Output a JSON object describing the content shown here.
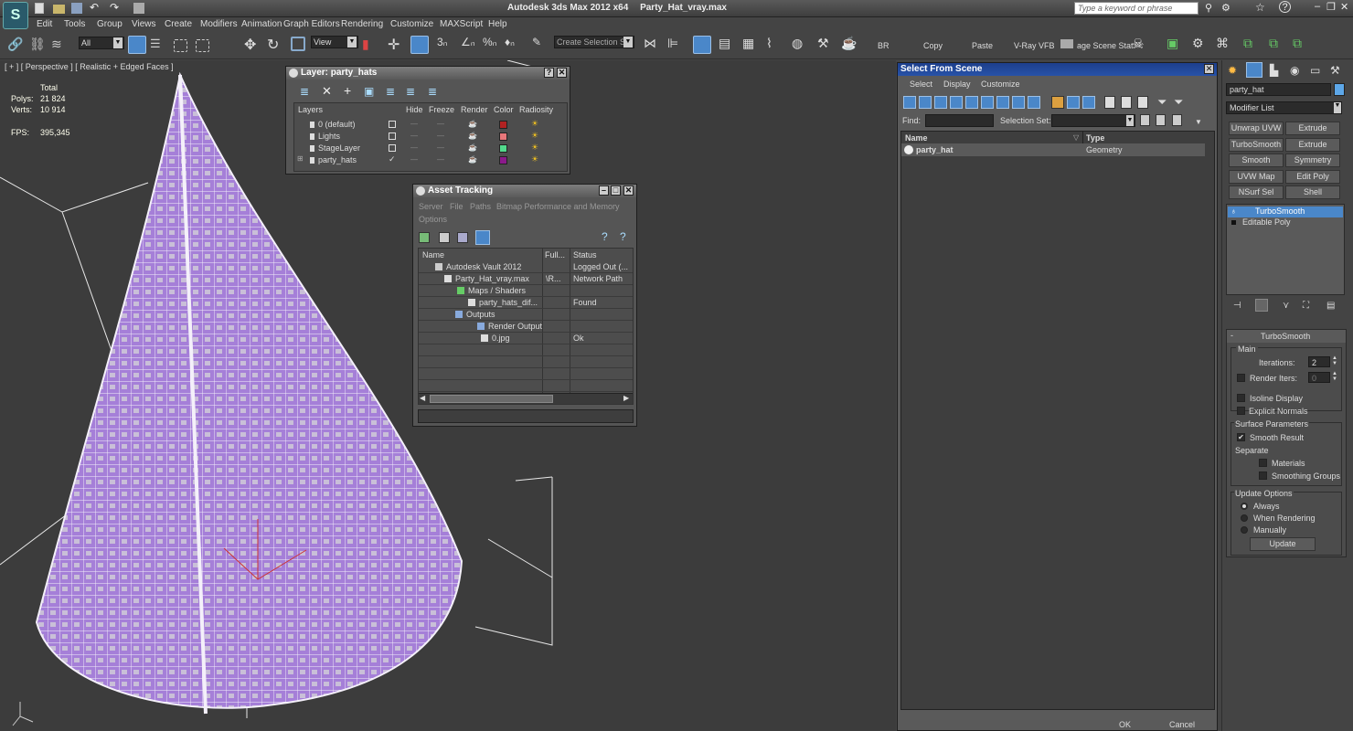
{
  "title": {
    "app": "Autodesk 3ds Max  2012 x64",
    "file": "Party_Hat_vray.max",
    "search_placeholder": "Type a keyword or phrase"
  },
  "menu": [
    "Edit",
    "Tools",
    "Group",
    "Views",
    "Create",
    "Modifiers",
    "Animation",
    "Graph Editors",
    "Rendering",
    "Customize",
    "MAXScript",
    "Help"
  ],
  "toolbar": {
    "filter": "All",
    "view": "View",
    "selset_placeholder": "Create Selection Se",
    "br": "BR",
    "copy": "Copy",
    "paste": "Paste",
    "vfb": "V-Ray VFB",
    "scene_states": "age Scene Stat"
  },
  "viewport": {
    "label": "[ + ] [ Perspective ] [ Realistic + Edged Faces ]",
    "stats": {
      "total_label": "Total",
      "polys_label": "Polys:",
      "polys": "21 824",
      "verts_label": "Verts:",
      "verts": "10 914",
      "fps_label": "FPS:",
      "fps": "395,345"
    },
    "mesh_color": "#a57fd8"
  },
  "layer_dialog": {
    "title": "Layer: party_hats",
    "columns": [
      "Layers",
      "Hide",
      "Freeze",
      "Render",
      "Color",
      "Radiosity"
    ],
    "rows": [
      {
        "name": "0 (default)",
        "color": "#b22222"
      },
      {
        "name": "Lights",
        "color": "#e8777a"
      },
      {
        "name": "StageLayer",
        "color": "#52d98c"
      },
      {
        "name": "party_hats",
        "color": "#8b1a8b"
      }
    ]
  },
  "asset_tracking": {
    "title": "Asset Tracking",
    "menu": [
      "Server",
      "File",
      "Paths",
      "Bitmap Performance and Memory"
    ],
    "menu2": "Options",
    "columns": [
      "Name",
      "Full...",
      "Status"
    ],
    "rows": [
      {
        "name": "Autodesk Vault 2012",
        "full": "",
        "status": "Logged Out (..."
      },
      {
        "name": "Party_Hat_vray.max",
        "full": "\\R...",
        "status": "Network Path"
      },
      {
        "name": "Maps / Shaders",
        "full": "",
        "status": ""
      },
      {
        "name": "party_hats_dif...",
        "full": "",
        "status": "Found"
      },
      {
        "name": "Outputs",
        "full": "",
        "status": ""
      },
      {
        "name": "Render Output",
        "full": "",
        "status": ""
      },
      {
        "name": "0.jpg",
        "full": "",
        "status": "Ok"
      }
    ]
  },
  "select_from_scene": {
    "title": "Select From Scene",
    "menu": [
      "Select",
      "Display",
      "Customize"
    ],
    "find_label": "Find:",
    "selset_label": "Selection Set:",
    "columns": [
      "Name",
      "Type"
    ],
    "rows": [
      {
        "name": "party_hat",
        "type": "Geometry"
      }
    ],
    "ok": "OK",
    "cancel": "Cancel"
  },
  "command_panel": {
    "object_name": "party_hat",
    "object_color": "#5da7e8",
    "modifier_list": "Modifier List",
    "buttons": [
      "Unwrap UVW",
      "Extrude",
      "TurboSmooth",
      "Extrude",
      "Smooth",
      "Symmetry",
      "UVW Map",
      "Edit Poly",
      "NSurf Sel",
      "Shell"
    ],
    "stack": [
      "TurboSmooth",
      "Editable Poly"
    ],
    "rollout_title": "TurboSmooth",
    "main_label": "Main",
    "iterations_label": "Iterations:",
    "iterations": "2",
    "render_iters_label": "Render Iters:",
    "render_iters": "0",
    "isoline": "Isoline Display",
    "explicit": "Explicit Normals",
    "surface_params": "Surface Parameters",
    "smooth_result": "Smooth Result",
    "separate": "Separate",
    "materials": "Materials",
    "smoothing_groups": "Smoothing Groups",
    "update_options": "Update Options",
    "always": "Always",
    "when_rendering": "When Rendering",
    "manually": "Manually",
    "update": "Update"
  }
}
